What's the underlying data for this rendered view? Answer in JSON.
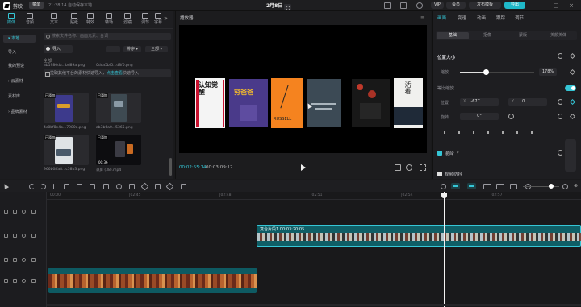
{
  "app": {
    "name": "剪映",
    "menu_label": "菜单",
    "autosave": "21:28:14 自动保存本地",
    "project_title": "2月8日",
    "vip_label": "VIP",
    "redeem_label": "会员",
    "template_label": "发布模板",
    "export_label": "导出"
  },
  "media": {
    "tabs": [
      {
        "label": "媒体",
        "icon": "media-icon"
      },
      {
        "label": "音频",
        "icon": "audio-icon"
      },
      {
        "label": "文本",
        "icon": "text-icon"
      },
      {
        "label": "贴纸",
        "icon": "sticker-icon"
      },
      {
        "label": "特效",
        "icon": "effects-icon"
      },
      {
        "label": "转场",
        "icon": "transition-icon"
      },
      {
        "label": "滤镜",
        "icon": "filter-icon"
      },
      {
        "label": "调节",
        "icon": "adjust-icon"
      },
      {
        "label": "字幕",
        "icon": "caption-icon"
      }
    ],
    "side_nav": [
      "▾ 本地",
      "导入",
      "我的预设",
      "› 云素材",
      "素材库",
      "› 品牌素材"
    ],
    "search_placeholder": "搜索文件名称、画面元素、台词",
    "import_label": "导入",
    "sort_label": "排序 ▾",
    "filter_label": "全部 ▾",
    "all_label": "全部",
    "banner_text": "拉取其他平台的素材快速导入，",
    "banner_link": "点击查看",
    "banner_suffix": "快速导入",
    "files": [
      {
        "name": "ab1980da...bd89a.png",
        "tag": ""
      },
      {
        "name": "0dca5bf5...d8f0.png",
        "tag": ""
      },
      {
        "name": "4c8bf8e4b...7980a.png",
        "tag": "已添加"
      },
      {
        "name": "ab3b6a0...5365.png",
        "tag": "已添加"
      },
      {
        "name": "966b0ffa8...c58b3.png",
        "tag": "已添加"
      },
      {
        "name": "录屏 (38).mp4",
        "tag": "已添加",
        "duration": "00:36"
      }
    ]
  },
  "player": {
    "title": "播放器",
    "time_current": "00:02:55:14",
    "time_total": "00:03:09:12",
    "books": [
      "认知觉醒",
      "穷爸爸",
      "RUSSELL",
      "",
      "",
      "活着"
    ]
  },
  "props": {
    "tabs": [
      "画面",
      "变速",
      "动画",
      "跟踪",
      "调节"
    ],
    "subtabs": [
      "基础",
      "抠像",
      "蒙版",
      "美颜美体"
    ],
    "section_title": "位置大小",
    "scale_label": "缩放",
    "scale_value": "178%",
    "scale_fraction": 0.35,
    "uniform_label": "等比缩放",
    "position_label": "位置",
    "x_label": "X",
    "x_value": "-677",
    "y_label": "Y",
    "y_value": "0",
    "rotation_label": "旋转",
    "rotation_value": "0°",
    "blend_label": "混合",
    "video_ani_label": "视频防抖"
  },
  "timeline": {
    "ticks": [
      "00:00",
      "|02:45",
      "|02:48",
      "|02:51",
      "|02:54",
      "|02:57"
    ],
    "main_clip_label": "复合片段1  00:03:20:05",
    "accent": "#35c6d6"
  }
}
